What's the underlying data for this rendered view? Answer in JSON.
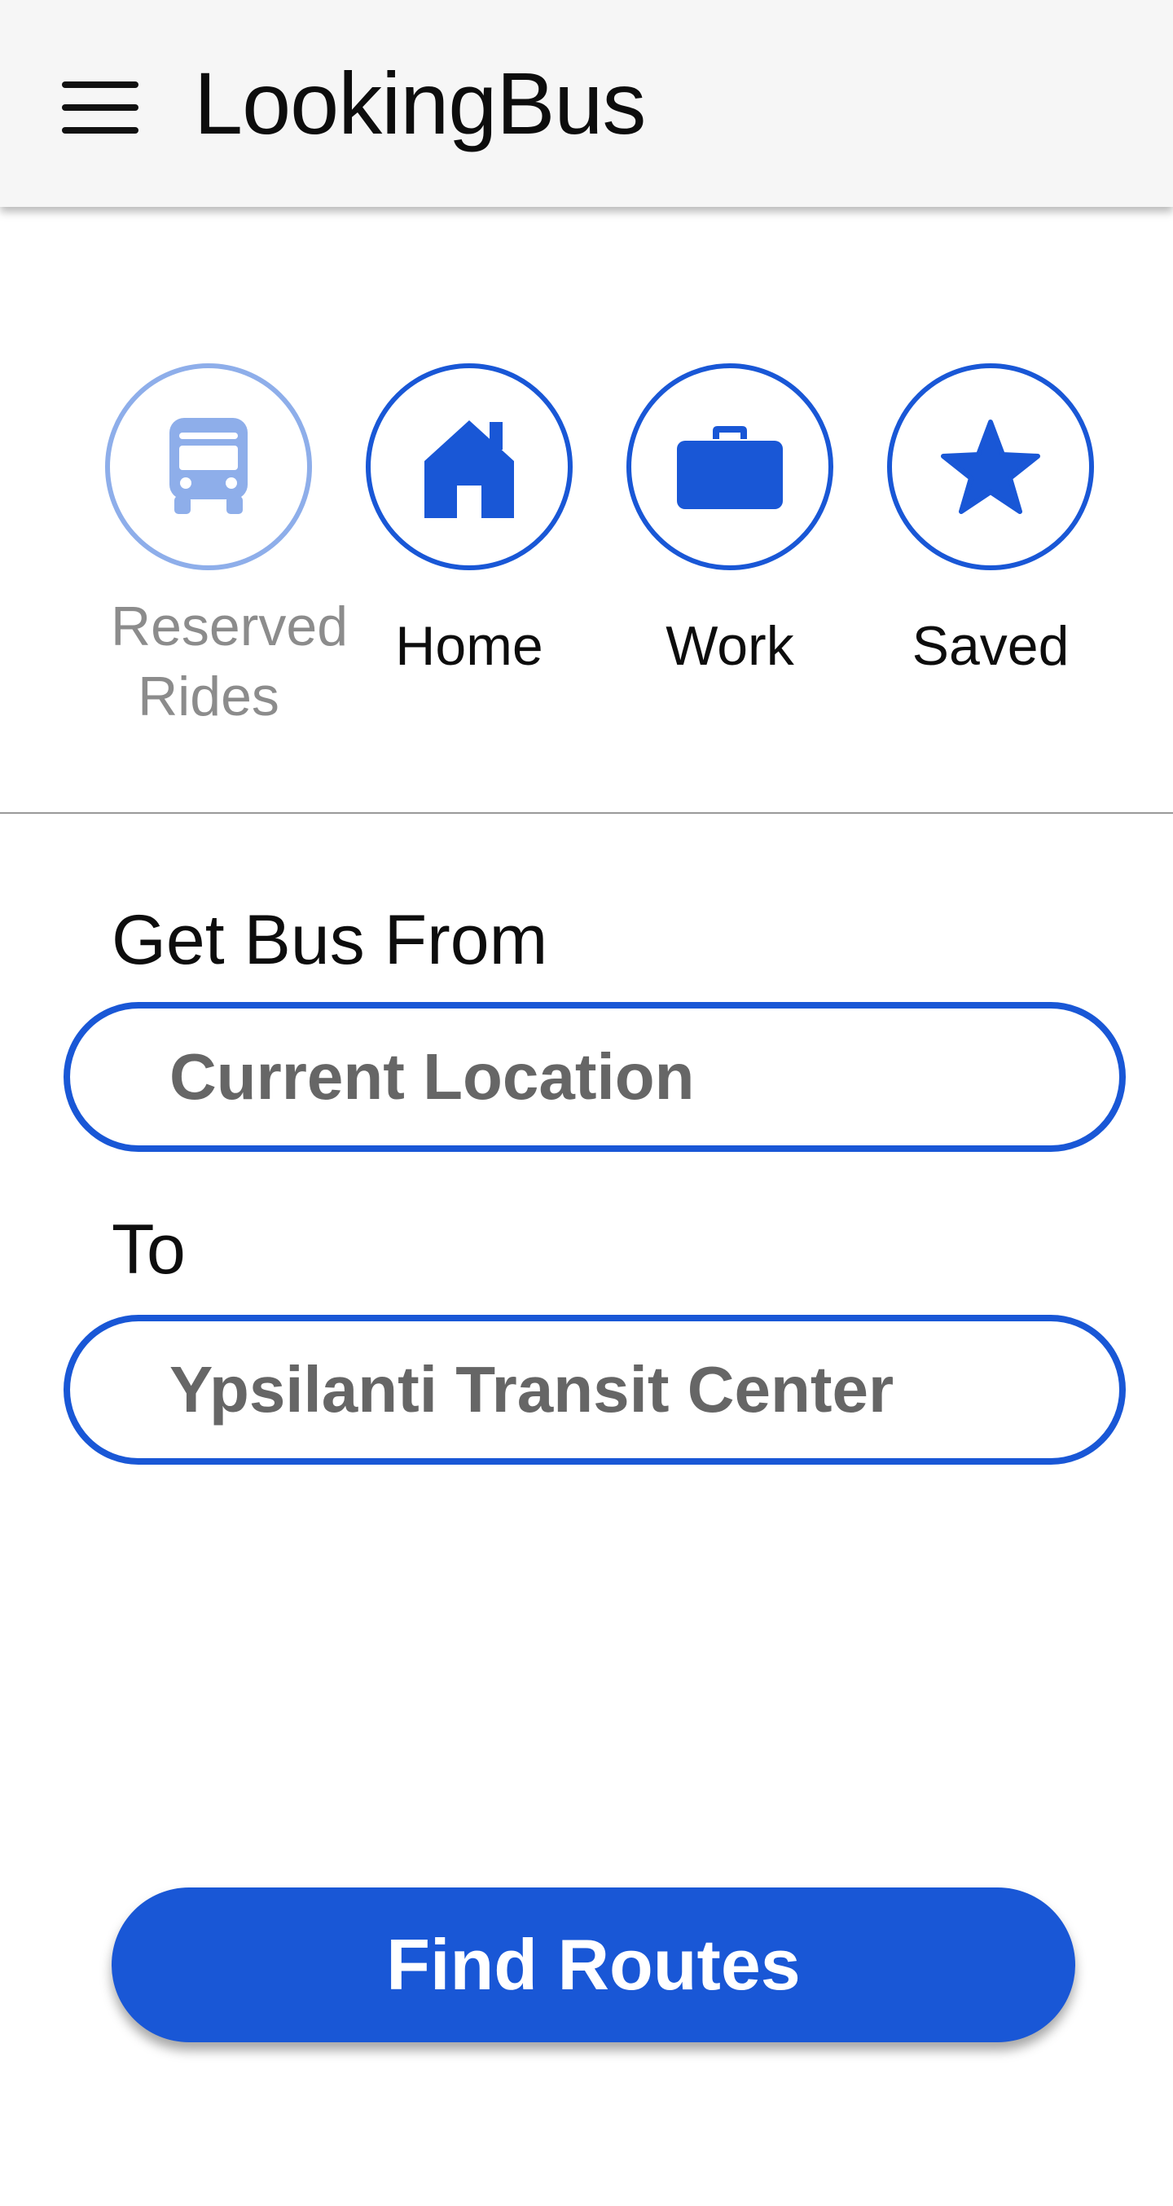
{
  "app_bar": {
    "title": "LookingBus",
    "menu_icon": "hamburger-menu-icon"
  },
  "quick_destinations": {
    "items": [
      {
        "label": "Reserved Rides",
        "icon": "bus-icon",
        "state": "disabled"
      },
      {
        "label": "Home",
        "icon": "home-icon",
        "state": "enabled"
      },
      {
        "label": "Work",
        "icon": "briefcase-icon",
        "state": "enabled"
      },
      {
        "label": "Saved",
        "icon": "star-icon",
        "state": "enabled"
      }
    ]
  },
  "trip_form": {
    "from_label": "Get Bus From",
    "from_value": "Current Location",
    "to_label": "To",
    "to_value": "Ypsilanti Transit Center",
    "submit_label": "Find Routes"
  },
  "colors": {
    "accent": "#1957d6",
    "accent_disabled": "#8eaeea",
    "app_bar_bg": "#f6f6f6",
    "field_text": "#666666",
    "disabled_text": "#8c8c8c"
  }
}
